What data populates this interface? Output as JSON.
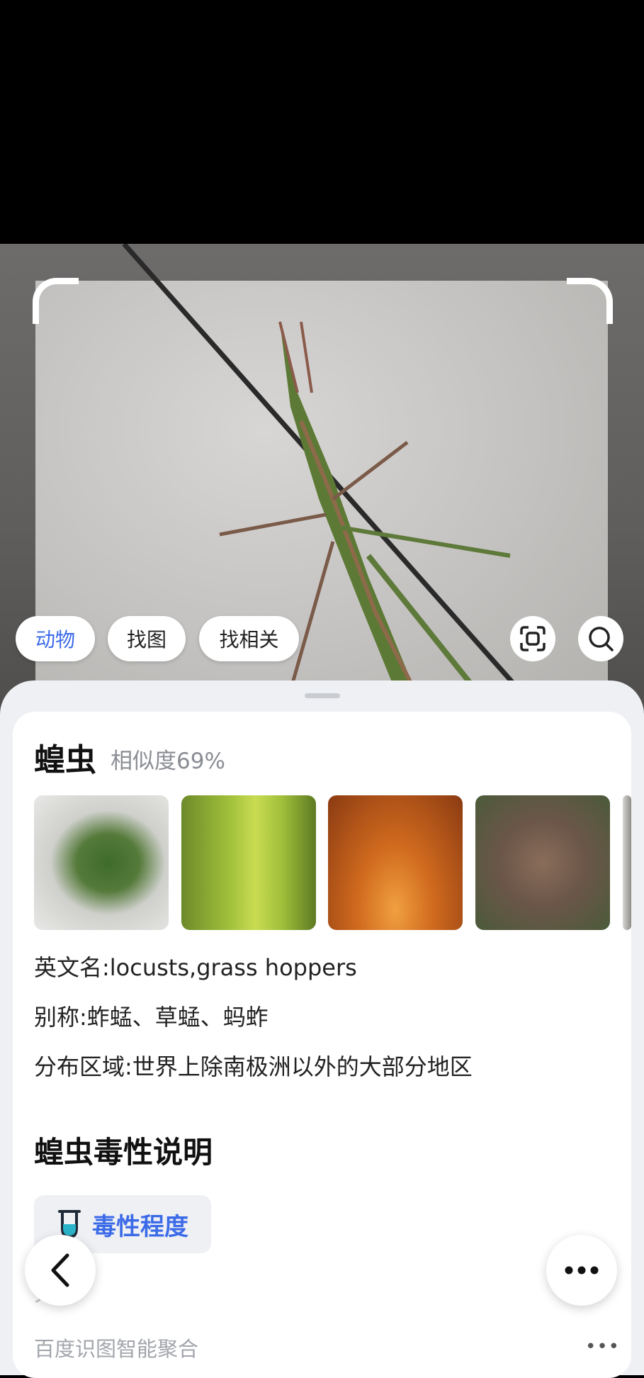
{
  "chips": {
    "category_label": "动物",
    "find_image_label": "找图",
    "find_related_label": "找相关"
  },
  "icons": {
    "scan": "scan-frame-icon",
    "search": "search-icon",
    "back": "chevron-left-icon",
    "more": "more-dots-icon",
    "toxicity": "test-tube-icon"
  },
  "result": {
    "name": "蝗虫",
    "similarity": "相似度69%",
    "english_name": "英文名:locusts,grass hoppers",
    "aliases": "别称:蚱蜢、草蜢、蚂蚱",
    "distribution": "分布区域:世界上除南极洲以外的大部分地区"
  },
  "toxicity": {
    "section_title": "蝗虫毒性说明",
    "tag_label": "毒性程度",
    "value": "无毒"
  },
  "footer": {
    "source": "百度识图智能聚合",
    "more": "•••"
  },
  "colors": {
    "accent": "#3c6be8",
    "sheet_bg": "#eef0f3"
  }
}
